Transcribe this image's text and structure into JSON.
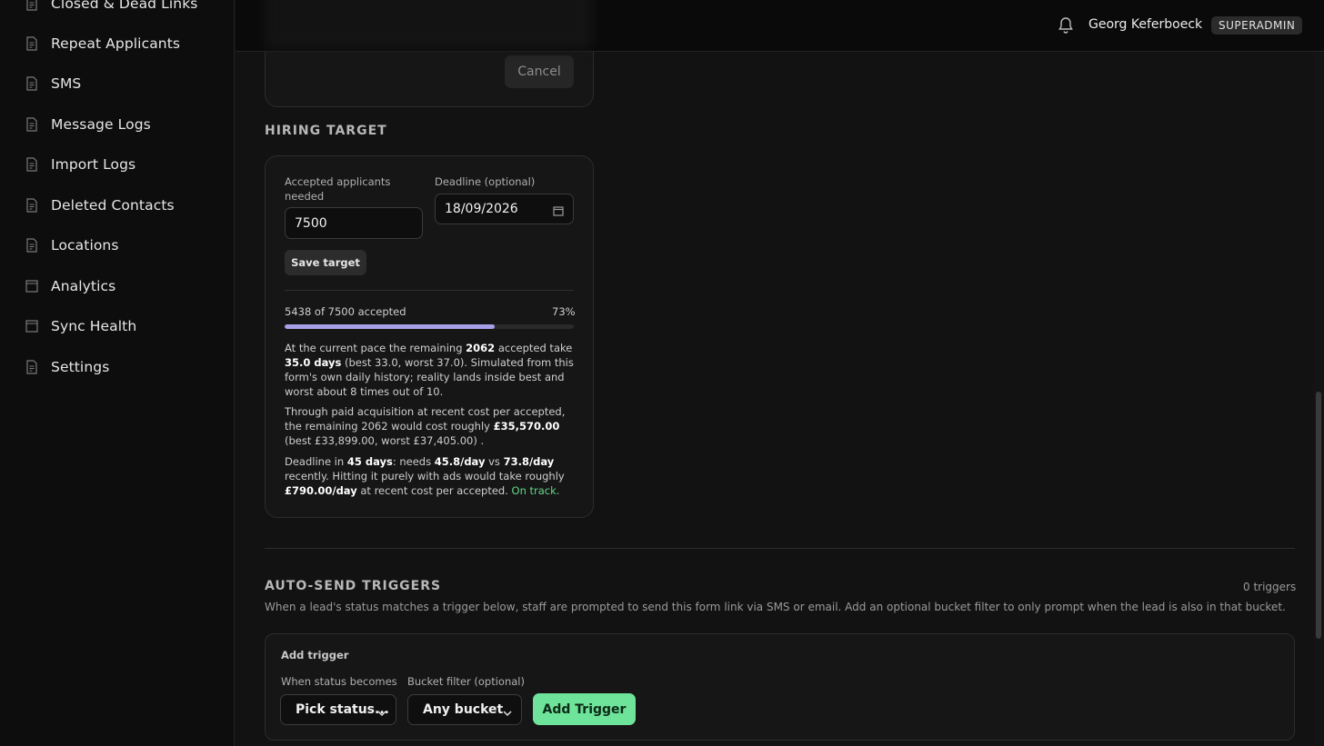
{
  "sidebar": {
    "items": [
      {
        "label": "Closed & Dead Links",
        "icon": "document-icon"
      },
      {
        "label": "Repeat Applicants",
        "icon": "document-icon"
      },
      {
        "label": "SMS",
        "icon": "document-icon"
      },
      {
        "label": "Message Logs",
        "icon": "document-icon"
      },
      {
        "label": "Import Logs",
        "icon": "document-icon"
      },
      {
        "label": "Deleted Contacts",
        "icon": "document-icon"
      },
      {
        "label": "Locations",
        "icon": "document-icon"
      },
      {
        "label": "Analytics",
        "icon": "chart-window-icon"
      },
      {
        "label": "Sync Health",
        "icon": "chart-window-icon"
      },
      {
        "label": "Settings",
        "icon": "document-icon"
      }
    ]
  },
  "header": {
    "user_name": "Georg Keferboeck",
    "role": "SUPERADMIN",
    "bell_icon": "bell-icon"
  },
  "previous_card": {
    "cancel_label": "Cancel"
  },
  "hiring_target": {
    "title": "HIRING TARGET",
    "accepted_label": "Accepted applicants needed",
    "accepted_value": "7500",
    "deadline_label": "Deadline (optional)",
    "deadline_value": "18/09/2026",
    "save_label": "Save target",
    "progress_text": "5438 of 7500 accepted",
    "progress_percent_text": "73%",
    "progress_fraction": 0.725,
    "pace": {
      "t1": "At the current pace the remaining ",
      "remaining": "2062",
      "t2": " accepted take ",
      "days": "35.0 days",
      "t3": " (best 33.0, worst 37.0). Simulated from this form's own daily history; reality lands inside best and worst about 8 times out of 10."
    },
    "cost": {
      "t1": "Through paid acquisition at recent cost per accepted, the remaining 2062 would cost roughly ",
      "amount": "£35,570.00",
      "t2": " (best £33,899.00, worst £37,405.00) ."
    },
    "deadline": {
      "t1": "Deadline in ",
      "days": "45 days",
      "t2": ": needs ",
      "needs": "45.8/day",
      "t3": " vs ",
      "recent": "73.8/day",
      "t4": " recently. Hitting it purely with ads would take roughly ",
      "ads": "£790.00/day",
      "t5": " at recent cost per accepted. ",
      "status": "On track."
    },
    "colors": {
      "progress": "#a7a0e8",
      "status_ok": "#5fd98a"
    }
  },
  "auto_send": {
    "title": "AUTO-SEND TRIGGERS",
    "count": "0 triggers",
    "description": "When a lead's status matches a trigger below, staff are prompted to send this form link via SMS or email. Add an optional bucket filter to only prompt when the lead is also in that bucket.",
    "add_trigger_title": "Add trigger",
    "status_label": "When status becomes",
    "status_value": "Pick status...",
    "bucket_label": "Bucket filter (optional)",
    "bucket_value": "Any bucket",
    "add_button": "Add Trigger",
    "accent": "#6ee39a"
  }
}
